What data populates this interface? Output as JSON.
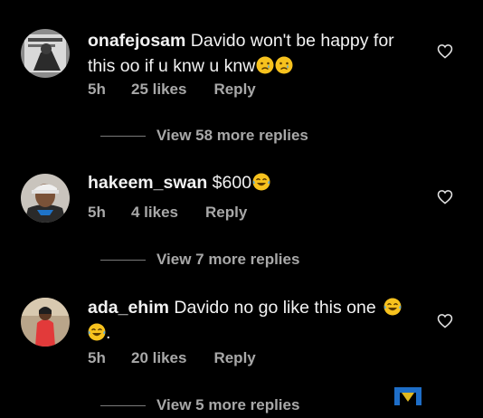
{
  "comments": [
    {
      "username": "onafejosam",
      "text": "Davido won't be happy for this oo if u knw u knw",
      "emojis": [
        "crying-face",
        "crying-face"
      ],
      "time": "5h",
      "likes": "25 likes",
      "reply_label": "Reply",
      "view_replies": "View 58 more replies"
    },
    {
      "username": "hakeem_swan",
      "text": "$600",
      "emojis": [
        "tears-of-joy-face"
      ],
      "time": "5h",
      "likes": "4 likes",
      "reply_label": "Reply",
      "view_replies": "View 7 more replies"
    },
    {
      "username": "ada_ehim",
      "text": "Davido no go like this one",
      "emojis": [
        "tears-of-joy-face",
        "tears-of-joy-face"
      ],
      "trailing": ".",
      "time": "5h",
      "likes": "20 likes",
      "reply_label": "Reply",
      "view_replies": "View 5 more replies"
    }
  ],
  "colors": {
    "background": "#000000",
    "text": "#f2f2f2",
    "secondary_text": "#a8a8a8",
    "emoji_yellow": "#f7c21e",
    "watermark_blue": "#1e6ec8"
  },
  "icons": [
    "heart-outline-icon",
    "crying-face-emoji",
    "tears-of-joy-emoji",
    "watermark-logo"
  ]
}
